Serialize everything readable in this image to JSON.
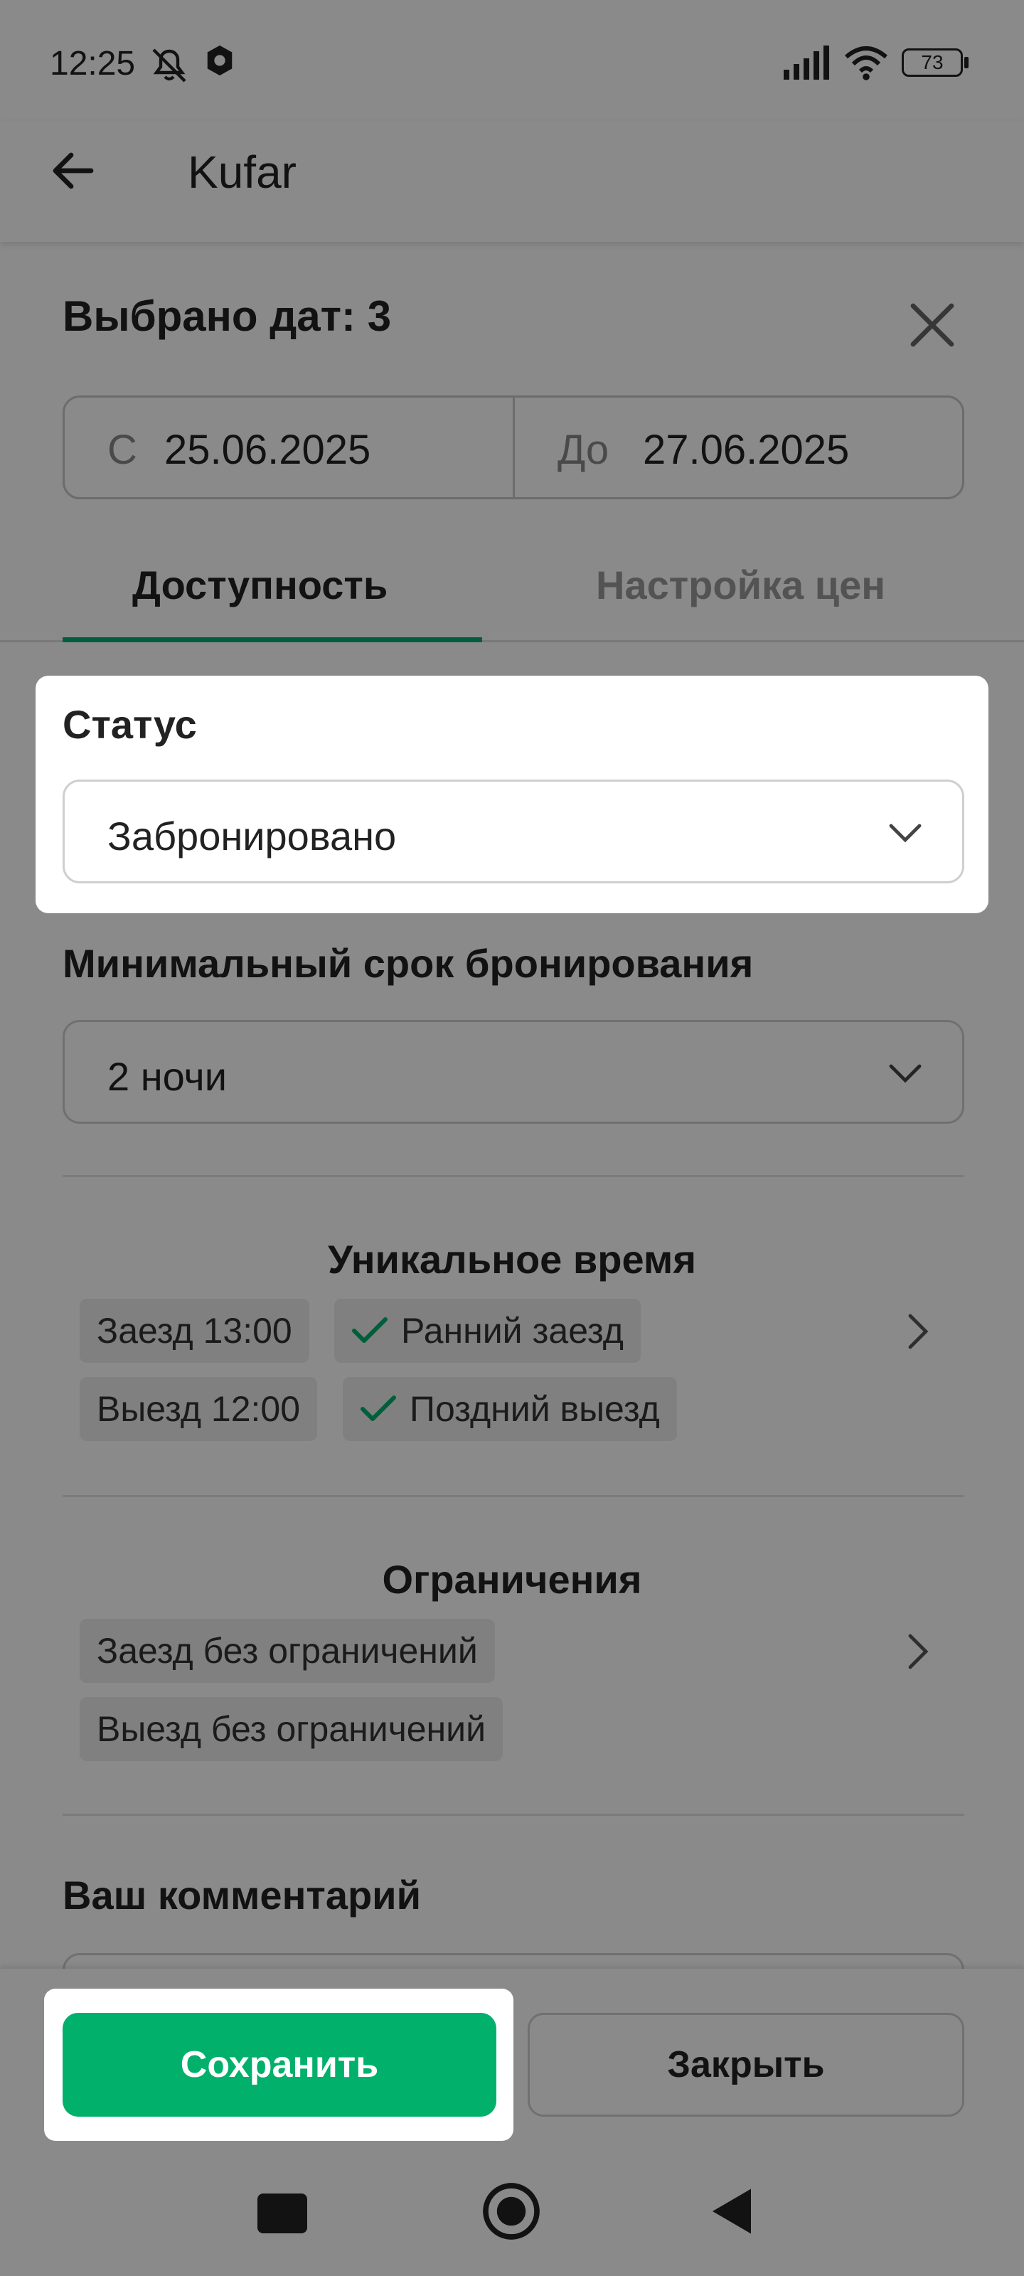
{
  "status_bar": {
    "time": "12:25",
    "battery": "73",
    "icons": [
      "bell-off-icon",
      "vpn-shield-icon",
      "signal-icon",
      "wifi-icon",
      "battery-icon"
    ]
  },
  "app_bar": {
    "title": "Kufar",
    "back_icon": "arrow-left-icon"
  },
  "sheet": {
    "title": "Выбрано дат: 3",
    "close_icon": "close-icon",
    "date_from": {
      "prefix": "С",
      "value": "25.06.2025"
    },
    "date_to": {
      "prefix": "До",
      "value": "27.06.2025"
    },
    "tabs": [
      {
        "label": "Доступность",
        "active": true
      },
      {
        "label": "Настройка цен",
        "active": false
      }
    ],
    "status": {
      "label": "Статус",
      "value": "Забронировано"
    },
    "min_stay": {
      "label": "Минимальный срок бронирования",
      "value": "2 ночи"
    },
    "unique_time": {
      "title": "Уникальное время",
      "chips": [
        "Заезд 13:00",
        "Ранний заезд",
        "Выезд 12:00",
        "Поздний выезд"
      ]
    },
    "restrictions": {
      "title": "Ограничения",
      "chips": [
        "Заезд без ограничений",
        "Выезд без ограничений"
      ]
    },
    "comment": {
      "label": "Ваш комментарий"
    }
  },
  "actions": {
    "save_label": "Сохранить",
    "close_label": "Закрыть"
  },
  "colors": {
    "accent": "#00b06b",
    "dim_overlay": "rgba(0,0,0,0.46)"
  }
}
